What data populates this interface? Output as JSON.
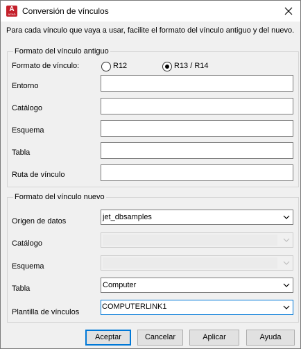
{
  "window": {
    "title": "Conversión de vínculos",
    "app_icon_letter": "A",
    "app_icon_sub": "ACAD"
  },
  "description": "Para cada vínculo que vaya a usar, facilite el formato del vínculo antiguo y del nuevo.",
  "old_format": {
    "legend": "Formato del vínculo antiguo",
    "link_format_label": "Formato de vínculo:",
    "radio_r12": {
      "label": "R12",
      "selected": false
    },
    "radio_r13_r14": {
      "label": "R13 / R14",
      "selected": true
    },
    "fields": {
      "environment": {
        "label": "Entorno",
        "value": ""
      },
      "catalog": {
        "label": "Catálogo",
        "value": ""
      },
      "schema": {
        "label": "Esquema",
        "value": ""
      },
      "table": {
        "label": "Tabla",
        "value": ""
      },
      "link_path": {
        "label": "Ruta de vínculo",
        "value": ""
      }
    }
  },
  "new_format": {
    "legend": "Formato del vínculo nuevo",
    "data_source": {
      "label": "Origen de datos",
      "value": "jet_dbsamples"
    },
    "catalog": {
      "label": "Catálogo",
      "value": "",
      "disabled": true
    },
    "schema": {
      "label": "Esquema",
      "value": "",
      "disabled": true
    },
    "table": {
      "label": "Tabla",
      "value": "Computer"
    },
    "link_template": {
      "label": "Plantilla de vínculos",
      "value": "COMPUTERLINK1"
    }
  },
  "buttons": {
    "ok": "Aceptar",
    "cancel": "Cancelar",
    "apply": "Aplicar",
    "help": "Ayuda"
  },
  "colors": {
    "accent": "#0078d7",
    "app_icon": "#c4202b",
    "dialog_bg": "#f0f0f0"
  },
  "icons": {
    "close": "close-icon",
    "chevron": "chevron-down-icon"
  }
}
